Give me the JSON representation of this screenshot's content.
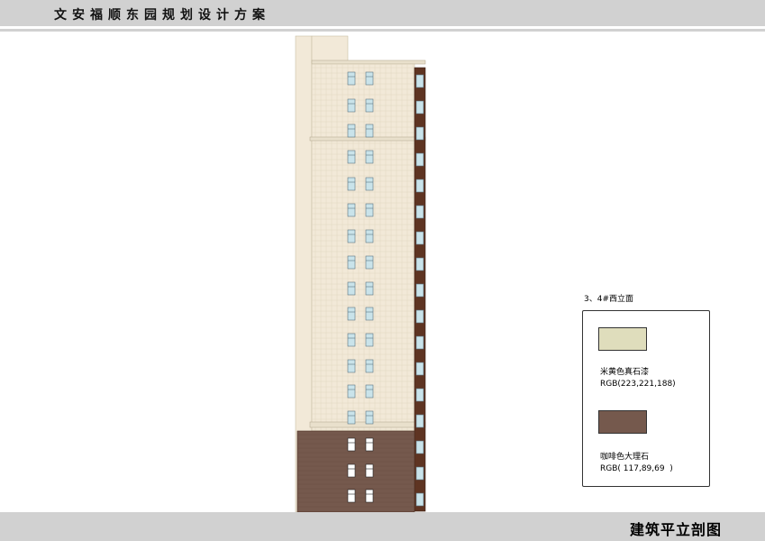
{
  "header": {
    "title": "文安福顺东园规划设计方案"
  },
  "footer": {
    "title": "建筑平立剖图"
  },
  "drawing": {
    "caption": "3、4#西立面",
    "colors": {
      "cream": "#dfddbc",
      "cream_light": "#f2e9d8",
      "brown": "#75594d",
      "brown_dark": "#5e3422",
      "glass": "#c9e3ea"
    }
  },
  "legend": {
    "items": [
      {
        "name": "米黄色真石漆",
        "rgb": "RGB(223,221,188)",
        "color": "#dfddbc"
      },
      {
        "name": "咖啡色大理石",
        "rgb": "RGB( 117,89,69  )",
        "color": "#75594d"
      }
    ]
  }
}
